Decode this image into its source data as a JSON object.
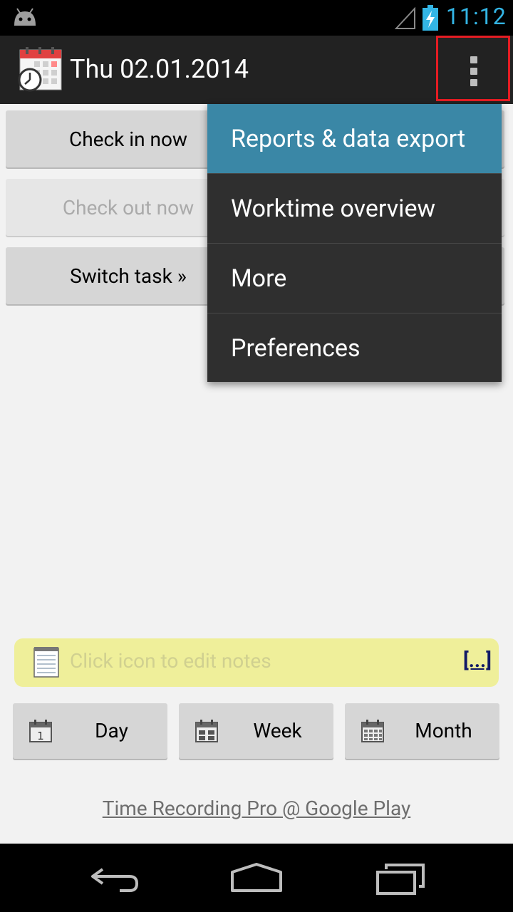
{
  "status_bar": {
    "time": "11:12",
    "icons": [
      "android-icon",
      "signal-icon",
      "battery-charging-icon"
    ],
    "time_color": "#33b5e5"
  },
  "action_bar": {
    "title": "Thu 02.01.2014",
    "app_icon": "calendar-clock-icon",
    "overflow_icon": "overflow-menu-icon",
    "highlight_color": "#e51c23"
  },
  "buttons": {
    "check_in": "Check in now",
    "check_out": "Check out now",
    "switch_task": "Switch task »"
  },
  "menu": {
    "items": [
      {
        "label": "Reports & data export",
        "selected": true
      },
      {
        "label": "Worktime overview",
        "selected": false
      },
      {
        "label": "More",
        "selected": false
      },
      {
        "label": "Preferences",
        "selected": false
      }
    ],
    "selected_color": "#3a87a6"
  },
  "notes": {
    "placeholder": "Click icon to edit notes",
    "more_link": "[...]",
    "icon": "notepad-icon"
  },
  "nav": {
    "day": "Day",
    "week": "Week",
    "month": "Month"
  },
  "footer": {
    "link": "Time Recording Pro @ Google Play"
  },
  "system_nav": {
    "icons": [
      "back-icon",
      "home-icon",
      "recent-apps-icon"
    ]
  }
}
